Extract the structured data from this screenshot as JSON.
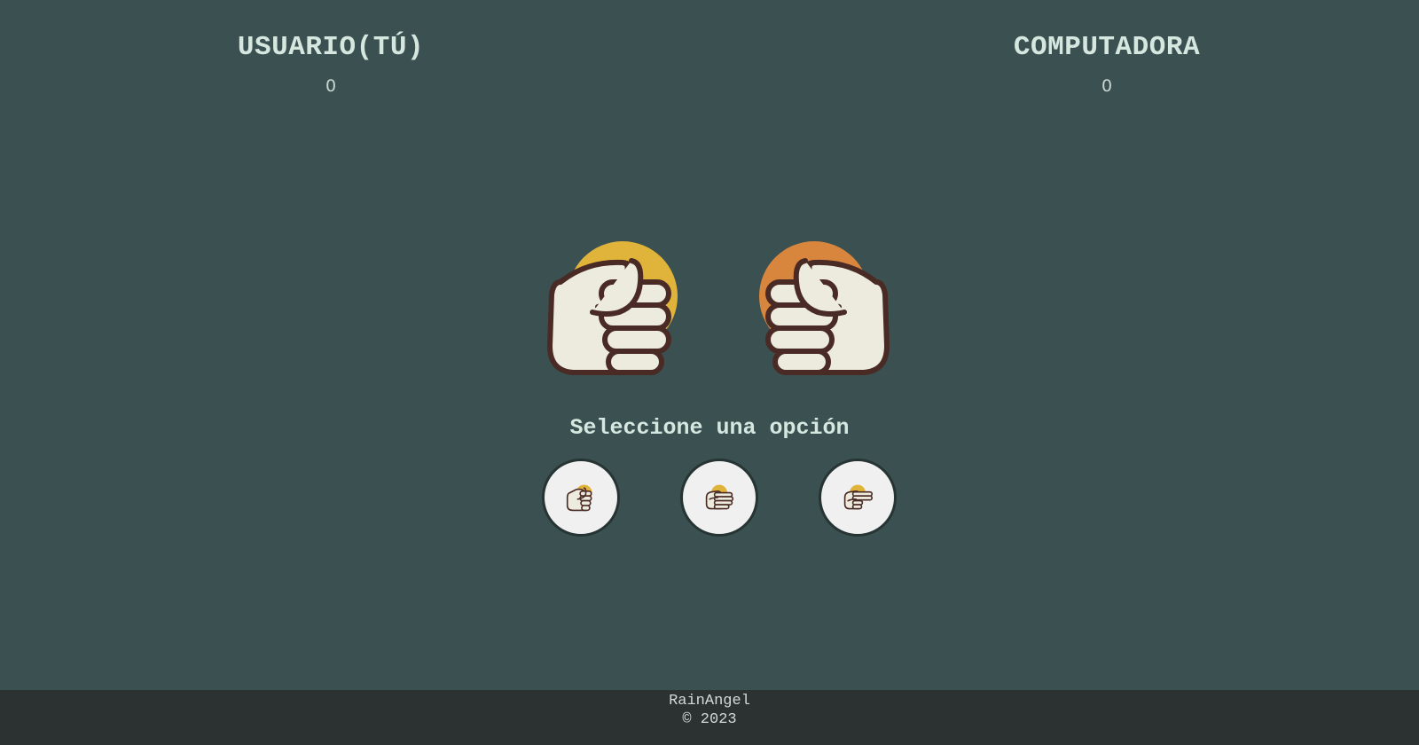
{
  "colors": {
    "background": "#3b5050",
    "footer_background": "#2c3232",
    "title_text": "#d6e7df",
    "user_circle": "#e0b43a",
    "computer_circle": "#d8863e",
    "hand_fill": "#ecebdd",
    "hand_outline": "#4a2a25",
    "button_fill": "#f0f0f0"
  },
  "scoreboard": {
    "user": {
      "label": "USUARIO(TÚ)",
      "score": "0"
    },
    "computer": {
      "label": "COMPUTADORA",
      "score": "0"
    }
  },
  "arena": {
    "user_hand_icon": "rock-fist-icon",
    "computer_hand_icon": "rock-fist-icon"
  },
  "prompt": "Seleccione una opción",
  "options": [
    {
      "value": "piedra",
      "icon": "rock-fist-icon"
    },
    {
      "value": "papel",
      "icon": "paper-hand-icon"
    },
    {
      "value": "tijera",
      "icon": "scissors-hand-icon"
    }
  ],
  "footer": {
    "author": "RainAngel",
    "copyright": "© 2023"
  }
}
